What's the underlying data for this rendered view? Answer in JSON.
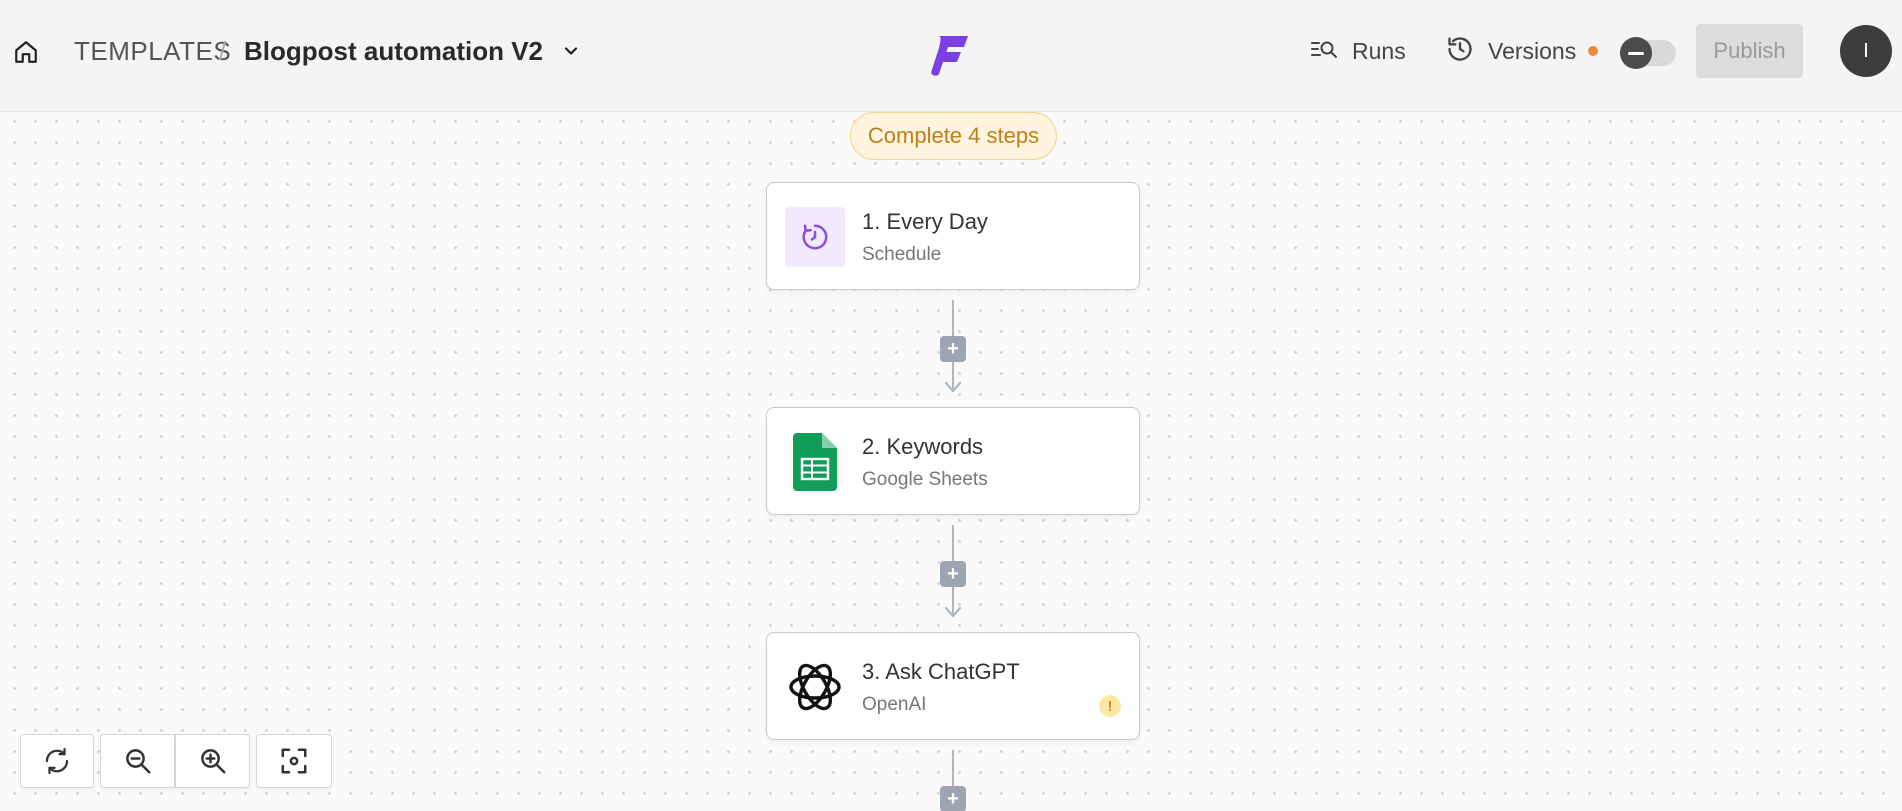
{
  "header": {
    "home_icon": "home-icon",
    "breadcrumb_root": "TEMPLATES",
    "breadcrumb_separator": "/",
    "flow_title": "Blogpost automation V2",
    "title_menu_icon": "chevron-down-icon",
    "logo": "brand-logo",
    "runs_label": "Runs",
    "runs_icon": "runs-search-icon",
    "versions_label": "Versions",
    "versions_icon": "history-icon",
    "versions_indicator_color": "#f0883a",
    "publish_label": "Publish",
    "avatar_initial": "I"
  },
  "canvas": {
    "status_badge": "Complete 4 steps",
    "steps": [
      {
        "title": "1. Every Day",
        "subtitle": "Schedule",
        "icon": "schedule-clock-icon",
        "warning": false
      },
      {
        "title": "2. Keywords",
        "subtitle": "Google Sheets",
        "icon": "google-sheets-icon",
        "warning": false
      },
      {
        "title": "3. Ask ChatGPT",
        "subtitle": "OpenAI",
        "icon": "openai-icon",
        "warning": true,
        "warning_text": "!"
      }
    ],
    "add_step_symbol": "+"
  },
  "controls": {
    "reset_icon": "refresh-icon",
    "zoom_out_icon": "zoom-out-icon",
    "zoom_in_icon": "zoom-in-icon",
    "fit_icon": "fit-view-icon"
  },
  "colors": {
    "accent": "#7b3fe4",
    "badge_text": "#c07f17",
    "badge_bg": "#fdf3de",
    "sheets_green": "#0f9d58"
  }
}
